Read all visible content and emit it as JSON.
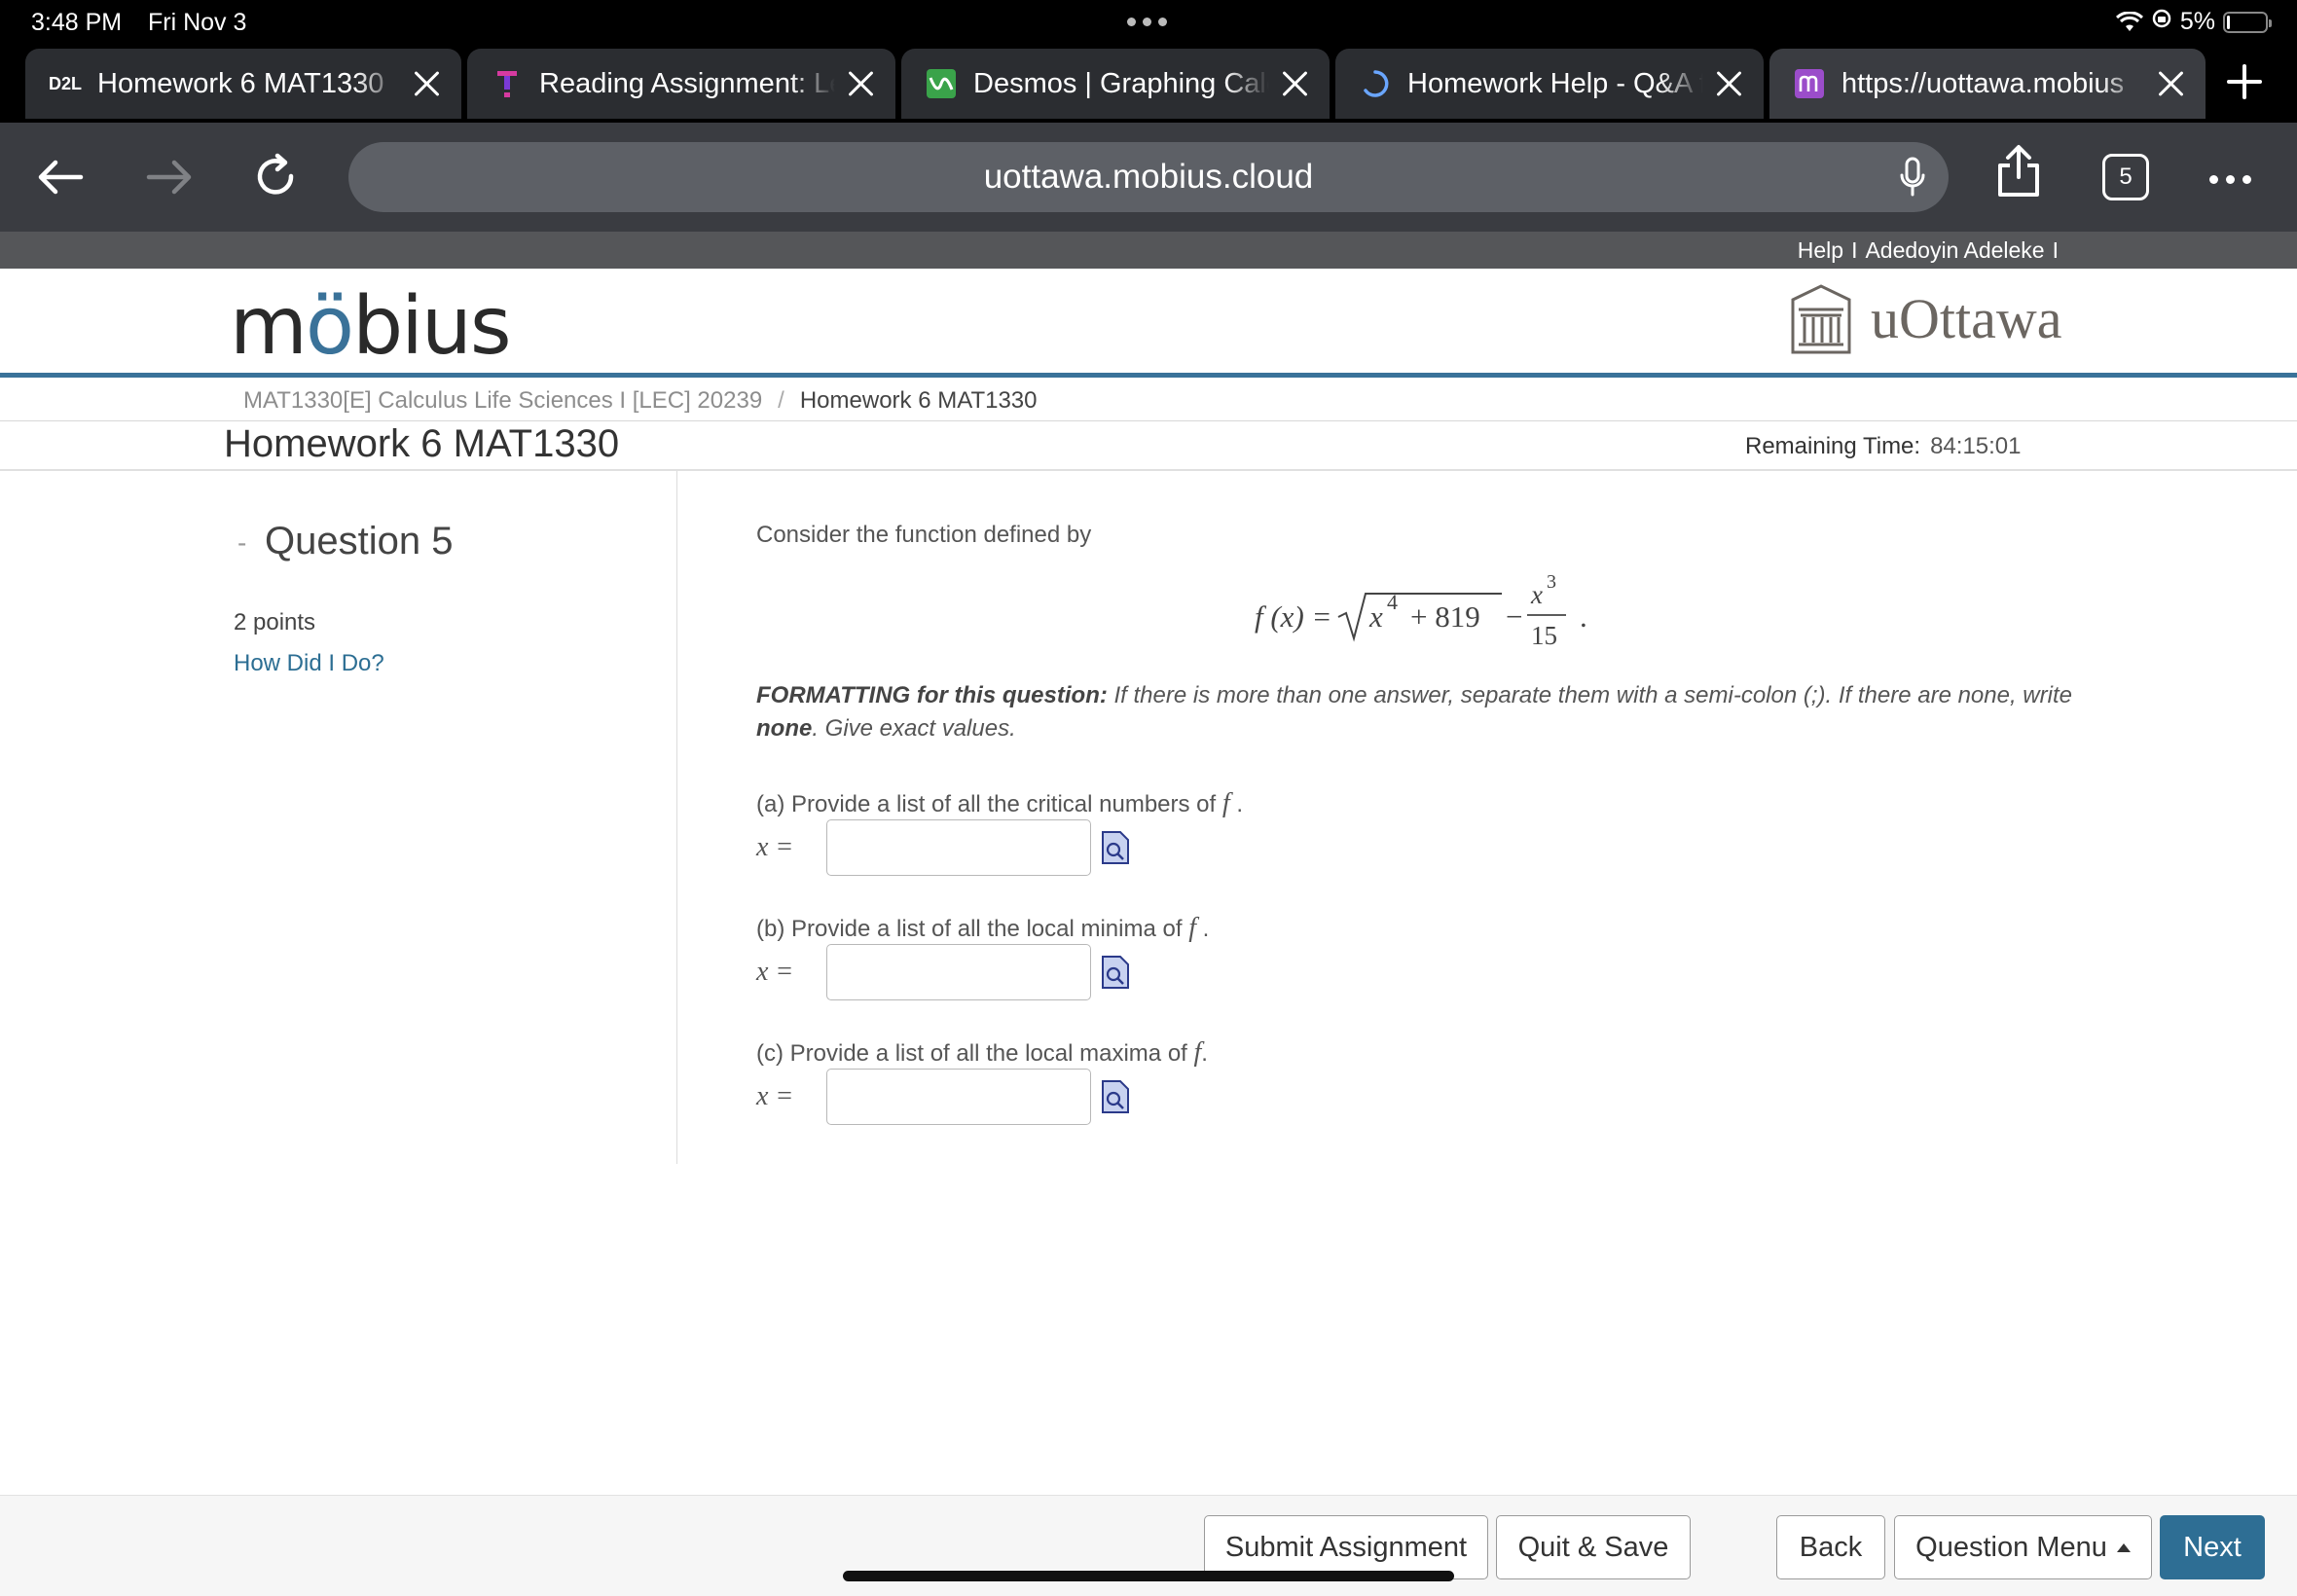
{
  "status_bar": {
    "time": "3:48 PM",
    "date": "Fri Nov 3",
    "battery": "5%"
  },
  "tabs": [
    {
      "favicon": "D2L",
      "title": "Homework 6 MAT1330",
      "color": "#ffffff"
    },
    {
      "favicon": "T",
      "title": "Reading Assignment: Le",
      "color": "#d63aa0"
    },
    {
      "favicon": "desmos",
      "title": "Desmos | Graphing Calc",
      "color": "#3aa34a"
    },
    {
      "favicon": "loading",
      "title": "Homework Help - Q&A f",
      "color": "#6aa6ff"
    },
    {
      "favicon": "m",
      "title": "https://uottawa.mobius",
      "color": "#9b4dca"
    }
  ],
  "toolbar": {
    "url": "uottawa.mobius.cloud",
    "tab_count": "5"
  },
  "header": {
    "help": "Help",
    "sep": "I",
    "user": "Adedoyin Adeleke",
    "logo": "möbius",
    "logo_parts": {
      "pre": "m",
      "o": "ö",
      "post": "bius"
    },
    "institution": "uOttawa"
  },
  "breadcrumb": {
    "course": "MAT1330[E] Calculus Life Sciences I [LEC] 20239",
    "separator": "/",
    "current": "Homework 6 MAT1330"
  },
  "assignment": {
    "title": "Homework 6 MAT1330",
    "remaining_label": "Remaining Time:",
    "remaining_value": "84:15:01"
  },
  "question": {
    "toggle": "-",
    "title": "Question 5",
    "points": "2 points",
    "how_did_i_do": "How Did I Do?",
    "intro": "Consider the function defined by",
    "formula": {
      "lhs": "f (x) =",
      "radicand_base": "x",
      "radicand_exp": "4",
      "radicand_rest": "+ 819",
      "minus": "−",
      "frac_num_base": "x",
      "frac_num_exp": "3",
      "frac_den": "15",
      "end": "."
    },
    "formatting_bold": "FORMATTING for this question:",
    "formatting_text1": " If there is more than one answer, separate them with a semi-colon (;). If there are none, write ",
    "formatting_none": "none",
    "formatting_text2": ".  Give exact values.",
    "parts": [
      {
        "prompt": "(a) Provide a list of all the critical numbers of",
        "var": "f",
        "end": ".",
        "label": "x =",
        "value": ""
      },
      {
        "prompt": "(b) Provide a list of all the local minima of",
        "var": "f",
        "end": ".",
        "label": "x =",
        "value": ""
      },
      {
        "prompt": "(c) Provide a list of all the local maxima of",
        "var": "f",
        "end": ".",
        "label": "x =",
        "value": ""
      }
    ]
  },
  "footer": {
    "submit": "Submit Assignment",
    "quit_save": "Quit & Save",
    "back": "Back",
    "question_menu": "Question Menu",
    "next": "Next"
  }
}
